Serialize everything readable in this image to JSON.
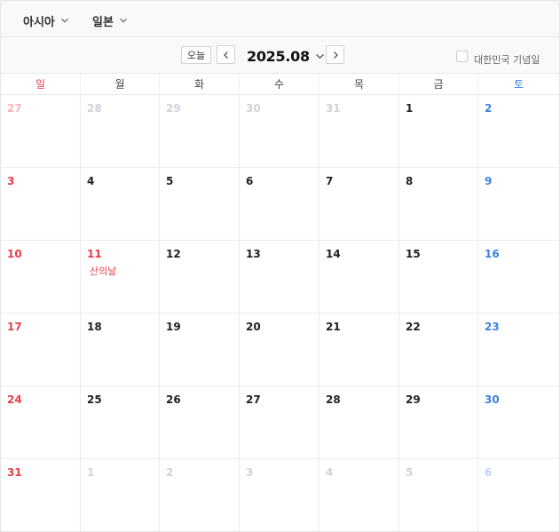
{
  "header": {
    "region": "아시아",
    "country": "일본"
  },
  "nav": {
    "today_label": "오늘",
    "year_month": "2025.08",
    "holiday_toggle_label": "대한민국 기념일"
  },
  "weekdays": [
    "일",
    "월",
    "화",
    "수",
    "목",
    "금",
    "토"
  ],
  "colors": {
    "sunday": "#e5414a",
    "saturday": "#3b82e0",
    "weekday": "#222222",
    "sunday_faded": "#f6b8bc",
    "saturday_faded": "#bcd4f3",
    "other_month": "#cfd3d8",
    "holiday_text": "#e5414a"
  },
  "weeks": [
    [
      {
        "day": "27",
        "other": true
      },
      {
        "day": "28",
        "other": true
      },
      {
        "day": "29",
        "other": true
      },
      {
        "day": "30",
        "other": true
      },
      {
        "day": "31",
        "other": true
      },
      {
        "day": "1",
        "other": false
      },
      {
        "day": "2",
        "other": false
      }
    ],
    [
      {
        "day": "3",
        "other": false
      },
      {
        "day": "4",
        "other": false
      },
      {
        "day": "5",
        "other": false
      },
      {
        "day": "6",
        "other": false
      },
      {
        "day": "7",
        "other": false
      },
      {
        "day": "8",
        "other": false
      },
      {
        "day": "9",
        "other": false
      }
    ],
    [
      {
        "day": "10",
        "other": false
      },
      {
        "day": "11",
        "other": false,
        "holiday": "산의날"
      },
      {
        "day": "12",
        "other": false
      },
      {
        "day": "13",
        "other": false
      },
      {
        "day": "14",
        "other": false
      },
      {
        "day": "15",
        "other": false
      },
      {
        "day": "16",
        "other": false
      }
    ],
    [
      {
        "day": "17",
        "other": false
      },
      {
        "day": "18",
        "other": false
      },
      {
        "day": "19",
        "other": false
      },
      {
        "day": "20",
        "other": false
      },
      {
        "day": "21",
        "other": false
      },
      {
        "day": "22",
        "other": false
      },
      {
        "day": "23",
        "other": false
      }
    ],
    [
      {
        "day": "24",
        "other": false
      },
      {
        "day": "25",
        "other": false
      },
      {
        "day": "26",
        "other": false
      },
      {
        "day": "27",
        "other": false
      },
      {
        "day": "28",
        "other": false
      },
      {
        "day": "29",
        "other": false
      },
      {
        "day": "30",
        "other": false
      }
    ],
    [
      {
        "day": "31",
        "other": false
      },
      {
        "day": "1",
        "other": true
      },
      {
        "day": "2",
        "other": true
      },
      {
        "day": "3",
        "other": true
      },
      {
        "day": "4",
        "other": true
      },
      {
        "day": "5",
        "other": true
      },
      {
        "day": "6",
        "other": true
      }
    ]
  ]
}
